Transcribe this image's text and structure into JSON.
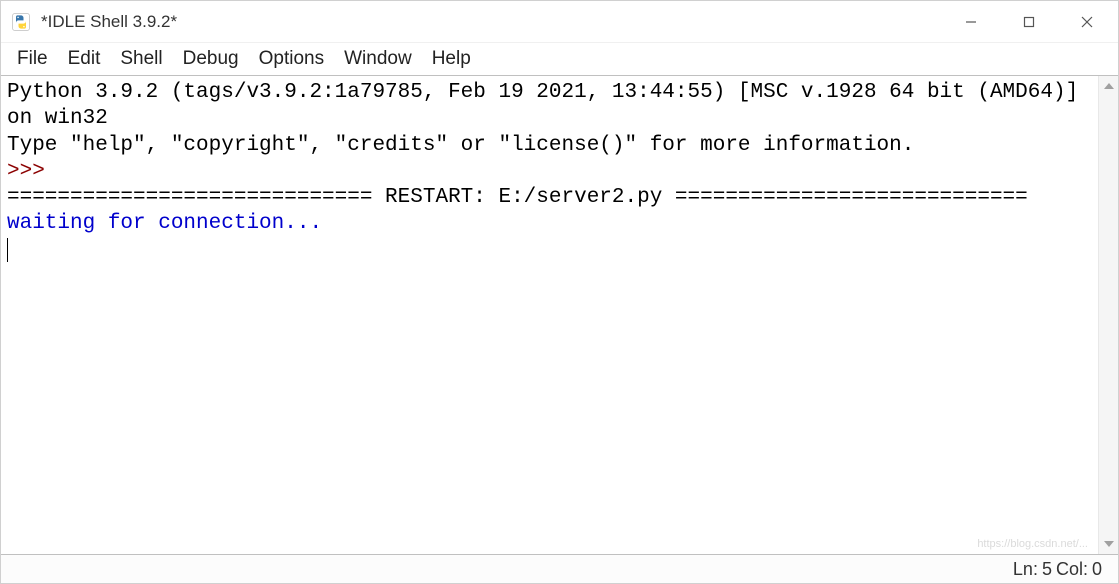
{
  "window": {
    "title": "*IDLE Shell 3.9.2*"
  },
  "menu": {
    "items": [
      "File",
      "Edit",
      "Shell",
      "Debug",
      "Options",
      "Window",
      "Help"
    ]
  },
  "shell": {
    "banner_line1": "Python 3.9.2 (tags/v3.9.2:1a79785, Feb 19 2021, 13:44:55) [MSC v.1928 64 bit (AMD64)] on win32",
    "banner_line2": "Type \"help\", \"copyright\", \"credits\" or \"license()\" for more information.",
    "prompt": ">>> ",
    "restart_line": "============================= RESTART: E:/server2.py ============================",
    "output_line": "waiting for connection..."
  },
  "status": {
    "ln_label": "Ln:",
    "ln_value": "5",
    "col_label": "Col:",
    "col_value": "0"
  },
  "watermark": "https://blog.csdn.net/..."
}
